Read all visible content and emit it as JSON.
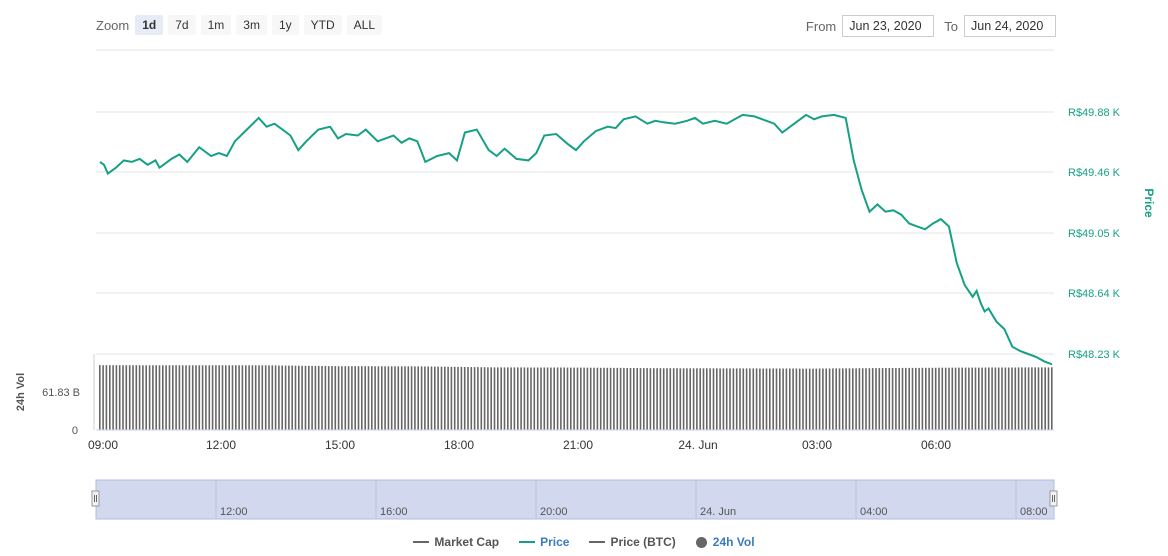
{
  "zoom": {
    "label": "Zoom",
    "buttons": [
      "1d",
      "7d",
      "1m",
      "3m",
      "1y",
      "YTD",
      "ALL"
    ],
    "active": "1d"
  },
  "range": {
    "from_label": "From",
    "from_value": "Jun 23, 2020",
    "to_label": "To",
    "to_value": "Jun 24, 2020"
  },
  "legend": [
    {
      "label": "Market Cap",
      "color": "#666666",
      "kind": "line"
    },
    {
      "label": "Price",
      "color": "#16a085",
      "kind": "line"
    },
    {
      "label": "Price (BTC)",
      "color": "#666666",
      "kind": "line"
    },
    {
      "label": "24h Vol",
      "color": "#666666",
      "kind": "dot"
    }
  ],
  "colors": {
    "price": "#16a085",
    "volume": "#666666",
    "grid": "#e6e6e6",
    "navigator_fill": "#d2d8ee"
  },
  "chart_data": {
    "type": "line",
    "x_ticks": [
      "09:00",
      "12:00",
      "15:00",
      "18:00",
      "21:00",
      "24. Jun",
      "03:00",
      "06:00"
    ],
    "y_ticks_price": [
      "R$49.88 K",
      "R$49.46 K",
      "R$49.05 K",
      "R$48.64 K",
      "R$48.23 K"
    ],
    "y_label_price": "Price",
    "y_label_volume": "24h Vol",
    "y_ticks_volume": [
      "61.83 B",
      "0"
    ],
    "navigator_ticks": [
      "12:00",
      "16:00",
      "20:00",
      "24. Jun",
      "04:00",
      "08:00"
    ],
    "price_series": {
      "name": "Price",
      "unit": "R$ K",
      "x_hours": [
        0,
        0.1,
        0.2,
        0.4,
        0.6,
        0.8,
        1.0,
        1.2,
        1.4,
        1.5,
        1.6,
        1.8,
        2.0,
        2.2,
        2.5,
        2.8,
        3.0,
        3.2,
        3.4,
        3.7,
        4.0,
        4.2,
        4.4,
        4.6,
        4.8,
        5.0,
        5.2,
        5.5,
        5.8,
        6.0,
        6.2,
        6.5,
        6.7,
        7.0,
        7.2,
        7.4,
        7.6,
        7.8,
        8.0,
        8.2,
        8.5,
        8.8,
        9.0,
        9.2,
        9.5,
        9.8,
        10.0,
        10.2,
        10.5,
        10.8,
        11.0,
        11.2,
        11.5,
        11.8,
        12.0,
        12.2,
        12.5,
        12.8,
        13.0,
        13.2,
        13.5,
        13.8,
        14.0,
        14.2,
        14.5,
        14.8,
        15.0,
        15.2,
        15.5,
        15.8,
        16.0,
        16.2,
        16.5,
        16.8,
        17.0,
        17.2,
        17.5,
        17.8,
        18.0,
        18.2,
        18.5,
        18.8,
        19.0,
        19.2,
        19.4,
        19.6,
        19.8,
        20.0,
        20.2,
        20.4,
        20.6,
        20.8,
        21.0,
        21.2,
        21.4,
        21.6,
        21.8,
        22.0,
        22.1,
        22.2,
        22.3,
        22.4,
        22.6,
        22.8,
        23.0,
        23.2,
        23.4,
        23.6,
        23.8,
        24.0
      ],
      "values": [
        49.54,
        49.52,
        49.46,
        49.5,
        49.55,
        49.54,
        49.56,
        49.52,
        49.55,
        49.5,
        49.52,
        49.56,
        49.59,
        49.54,
        49.64,
        49.58,
        49.6,
        49.58,
        49.68,
        49.76,
        49.84,
        49.78,
        49.8,
        49.76,
        49.72,
        49.62,
        49.68,
        49.76,
        49.78,
        49.7,
        49.73,
        49.72,
        49.76,
        49.68,
        49.7,
        49.72,
        49.67,
        49.7,
        49.68,
        49.54,
        49.58,
        49.6,
        49.55,
        49.74,
        49.76,
        49.62,
        49.58,
        49.63,
        49.56,
        49.55,
        49.6,
        49.72,
        49.73,
        49.66,
        49.62,
        49.68,
        49.75,
        49.78,
        49.77,
        49.83,
        49.85,
        49.8,
        49.82,
        49.81,
        49.8,
        49.82,
        49.84,
        49.8,
        49.82,
        49.8,
        49.83,
        49.86,
        49.85,
        49.82,
        49.8,
        49.74,
        49.8,
        49.86,
        49.83,
        49.85,
        49.86,
        49.84,
        49.55,
        49.35,
        49.2,
        49.25,
        49.2,
        49.21,
        49.18,
        49.12,
        49.1,
        49.08,
        49.12,
        49.15,
        49.1,
        48.85,
        48.7,
        48.62,
        48.66,
        48.58,
        48.52,
        48.54,
        48.45,
        48.4,
        48.28,
        48.25,
        48.23,
        48.21,
        48.18,
        48.16
      ],
      "ylim": [
        48.23,
        49.88
      ]
    },
    "volume_series": {
      "name": "24h Vol",
      "unit": "R$ B",
      "x_hours": [
        0,
        2,
        4,
        6,
        8,
        10,
        12,
        14,
        16,
        18,
        20,
        22,
        24
      ],
      "values": [
        64.0,
        63.8,
        63.9,
        63.0,
        62.8,
        61.8,
        61.6,
        61.0,
        60.8,
        60.6,
        61.2,
        61.6,
        61.83
      ],
      "ylim": [
        0,
        75
      ]
    },
    "grid": true,
    "legend_position": "bottom-center"
  }
}
